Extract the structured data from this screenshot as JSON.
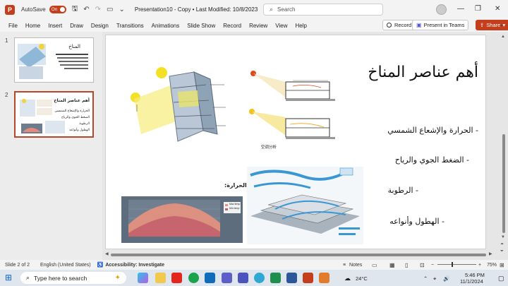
{
  "titlebar": {
    "app_icon": "P",
    "autosave_label": "AutoSave",
    "autosave_state": "On",
    "doc_title": "Presentation10 - Copy • Last Modified: 10/8/2023",
    "search_placeholder": "Search"
  },
  "ribbon": {
    "tabs": [
      "File",
      "Home",
      "Insert",
      "Draw",
      "Design",
      "Transitions",
      "Animations",
      "Slide Show",
      "Record",
      "Review",
      "View",
      "Help"
    ],
    "record_label": "Record",
    "present_teams_label": "Present in Teams",
    "share_label": "Share"
  },
  "thumbnails": [
    {
      "number": "1",
      "title": "المناخ",
      "lines": [
        "أهمية الغلاف المناخي..."
      ]
    },
    {
      "number": "2",
      "title": "أهم عناصر المناخ",
      "lines": [
        "الحرارة والإشعاع الشمسي",
        "الضغط الجوي والرياح",
        "الرطوبة",
        "الهطول وأنواعه"
      ]
    }
  ],
  "slide": {
    "title": "أهم عناصر المناخ",
    "bullets": [
      "- الحرارة والإشعاع الشمسي",
      "- الضغط الجوي والرياح",
      "- الرطوبة",
      "- الهطول وأنواعه"
    ],
    "heat_label": "الحرارة:",
    "section_caption": "空调分析",
    "chart_legend": [
      "Max temp",
      "Min temp"
    ]
  },
  "status": {
    "slide_of": "Slide 2 of 2",
    "language": "English (United States)",
    "accessibility": "Accessibility: Investigate",
    "notes_label": "Notes",
    "zoom": "75%"
  },
  "taskbar": {
    "search_placeholder": "Type here to search",
    "weather": "24°C",
    "time": "5:46 PM",
    "date": "11/1/2024"
  },
  "colors": {
    "accent": "#c43e1c",
    "thumb_selected": "#b7472a"
  }
}
